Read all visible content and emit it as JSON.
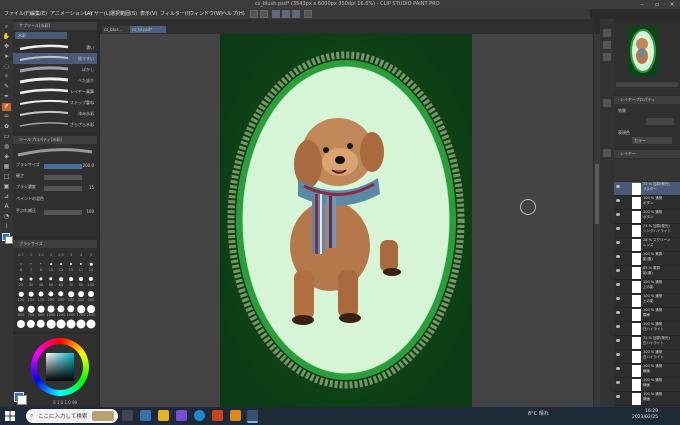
{
  "window": {
    "title": "cs_blush.psd* (3543px x 6000px 350dpi 16.6%) - CLIP STUDIO PAINT PRO"
  },
  "menu": [
    "ファイル(F)",
    "編集(E)",
    "アニメーション(A)",
    "レイヤー(L)",
    "選択範囲(S)",
    "表示(V)",
    "フィルター(I)",
    "ウィンドウ(W)",
    "ヘルプ(H)"
  ],
  "tabs": [
    {
      "label": "cs_blus..."
    },
    {
      "label": "cs_bl.psd*"
    }
  ],
  "subtool": {
    "header": "サブツール[水彩]",
    "group": "水彩",
    "brushes": [
      {
        "label": "濃い"
      },
      {
        "label": "極うすい"
      },
      {
        "label": "ぼかし"
      },
      {
        "label": "べた塗り"
      },
      {
        "label": "レイヤー乗算"
      },
      {
        "label": "ステップ重ね"
      },
      {
        "label": "滲み水彩"
      },
      {
        "label": "ざらざら水彩"
      }
    ]
  },
  "tool_property": {
    "header": "ツールプロパティ[水彩]",
    "brush_size_label": "ブラシサイズ",
    "brush_size_value": "200.0",
    "hardness_label": "硬さ",
    "opacity_label": "ブラシ濃度",
    "opacity_value": "15",
    "blend_label": "ペイントの混色",
    "correction_label": "手ぶれ補正",
    "correction_value": "100"
  },
  "brush_size_panel": {
    "header": "ブラシサイズ",
    "sizes": [
      "0.7",
      "1",
      "1.5",
      "2",
      "2.5",
      "3",
      "4",
      "5",
      "6",
      "7",
      "8",
      "10",
      "12",
      "15",
      "17",
      "20",
      "25",
      "30",
      "40",
      "50",
      "60",
      "70",
      "80",
      "100",
      "120",
      "150",
      "170",
      "200",
      "250",
      "300",
      "400",
      "500",
      "600",
      "700",
      "800",
      "1000",
      "1200",
      "1500",
      "1700",
      "2000"
    ]
  },
  "color": {
    "readout": "0 1.0  1.0  99"
  },
  "layer_property": {
    "header": "レイヤープロパティ",
    "effect_label": "効果",
    "color_label": "表現色",
    "color_value": "カラー"
  },
  "layers": {
    "header": "レイヤー",
    "items": [
      {
        "name": "70 % 加算(発光)",
        "sub": "ラスター",
        "selected": true
      },
      {
        "name": "100 % 通常",
        "sub": "ボタン"
      },
      {
        "name": "100 % 通常",
        "sub": "ボタン"
      },
      {
        "name": "74 % 加算(発光)",
        "sub": "シングハイライト"
      },
      {
        "name": "28 % スクリーン",
        "sub": "レンズ"
      },
      {
        "name": "100 % 乗算",
        "sub": "影(紫)"
      },
      {
        "name": "85 % 乗算",
        "sub": "影(服)"
      },
      {
        "name": "100 % 通常",
        "sub": "上の影"
      },
      {
        "name": "100 % 通常",
        "sub": "上の影"
      },
      {
        "name": "100 % 通常",
        "sub": "模様"
      },
      {
        "name": "100 % 通常",
        "sub": "白ハイライト"
      },
      {
        "name": "74 % 加算(発光)",
        "sub": "白ハイライト"
      },
      {
        "name": "100 % 通常",
        "sub": "白ハイライト"
      },
      {
        "name": "100 % 通常",
        "sub": "線画"
      },
      {
        "name": "100 % 通常",
        "sub": "線画"
      },
      {
        "name": "100 % 通常",
        "sub": "線画"
      }
    ]
  },
  "taskbar": {
    "search_placeholder": "ここに入力して検索",
    "weather": "8°C  晴れ",
    "time": "16:29",
    "date": "2023/02/25"
  }
}
